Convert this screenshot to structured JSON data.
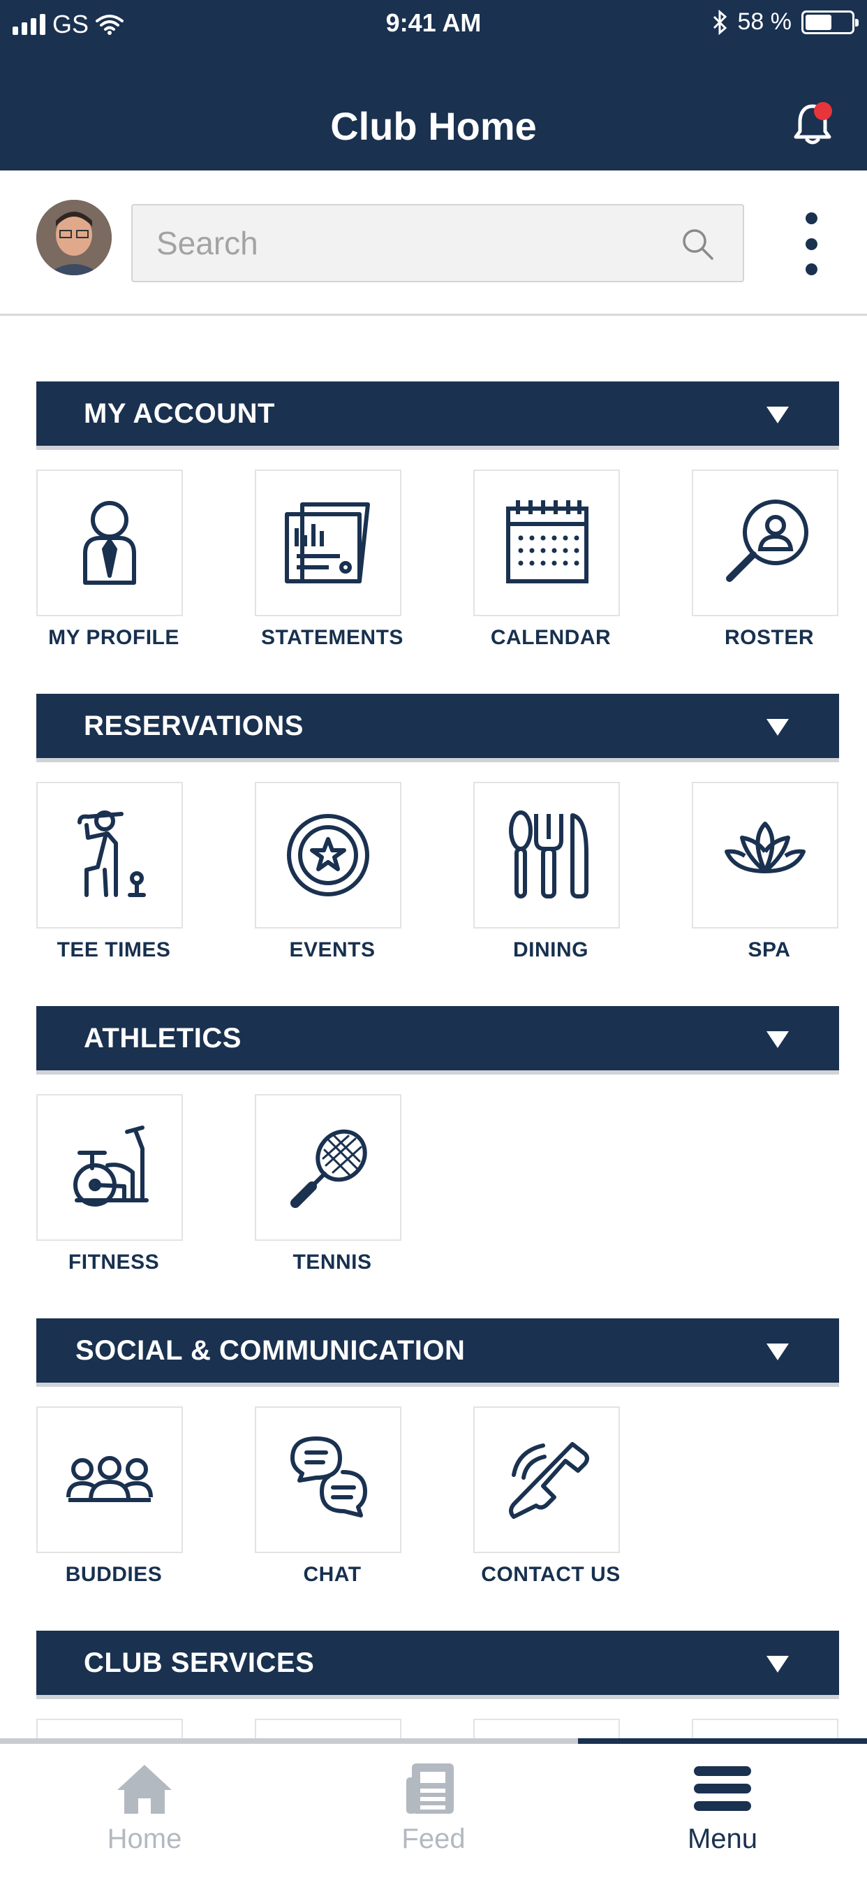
{
  "status_bar": {
    "carrier": "GS",
    "time": "9:41 AM",
    "battery": "58 %",
    "battery_level": 0.58
  },
  "header": {
    "title": "Club Home"
  },
  "search": {
    "placeholder": "Search"
  },
  "sections": [
    {
      "title": "MY ACCOUNT",
      "items": [
        {
          "label": "MY PROFILE",
          "icon": "profile-icon"
        },
        {
          "label": "STATEMENTS",
          "icon": "statements-icon"
        },
        {
          "label": "CALENDAR",
          "icon": "calendar-icon"
        },
        {
          "label": "ROSTER",
          "icon": "roster-icon"
        }
      ]
    },
    {
      "title": "RESERVATIONS",
      "items": [
        {
          "label": "TEE TIMES",
          "icon": "golfer-icon"
        },
        {
          "label": "EVENTS",
          "icon": "star-badge-icon"
        },
        {
          "label": "DINING",
          "icon": "cutlery-icon"
        },
        {
          "label": "SPA",
          "icon": "lotus-icon"
        }
      ]
    },
    {
      "title": "ATHLETICS",
      "items": [
        {
          "label": "FITNESS",
          "icon": "exercise-bike-icon"
        },
        {
          "label": "TENNIS",
          "icon": "tennis-racket-icon"
        }
      ]
    },
    {
      "title": "SOCIAL & COMMUNICATION",
      "items": [
        {
          "label": "BUDDIES",
          "icon": "group-icon"
        },
        {
          "label": "CHAT",
          "icon": "chat-bubbles-icon"
        },
        {
          "label": "CONTACT US",
          "icon": "phone-icon"
        }
      ]
    },
    {
      "title": "CLUB SERVICES",
      "items": []
    }
  ],
  "tabbar": {
    "items": [
      {
        "label": "Home",
        "icon": "home-icon",
        "active": false
      },
      {
        "label": "Feed",
        "icon": "feed-icon",
        "active": false
      },
      {
        "label": "Menu",
        "icon": "menu-icon",
        "active": true
      }
    ]
  },
  "colors": {
    "primary": "#1a3150",
    "notification": "#e8353a",
    "inactive": "#b3b9c0",
    "tile_border": "#e3e3e3"
  }
}
